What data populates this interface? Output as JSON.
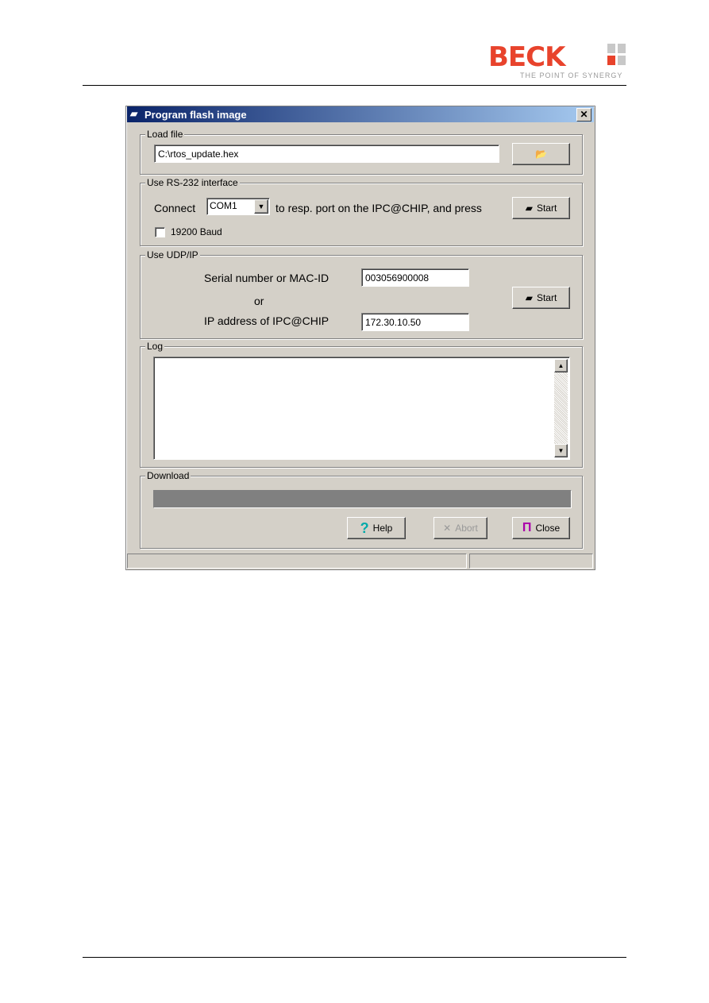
{
  "header": {
    "logo": "BECK",
    "tagline": "THE POINT OF SYNERGY"
  },
  "dialog": {
    "title": "Program flash image",
    "close": "✕",
    "load_file": {
      "label": "Load file",
      "path": "C:\\rtos_update.hex"
    },
    "rs232": {
      "label": "Use RS-232 interface",
      "connect": "Connect",
      "port": "COM1",
      "text": "to resp. port on the IPC@CHIP, and press",
      "start": "Start",
      "baud_label": "19200 Baud",
      "baud_checked": false
    },
    "udp": {
      "label": "Use UDP/IP",
      "serial_label": "Serial number or MAC-ID",
      "serial_value": "003056900008",
      "or": "or",
      "ip_label": "IP address of IPC@CHIP",
      "ip_value": "172.30.10.50",
      "start": "Start"
    },
    "log": {
      "label": "Log",
      "content": ""
    },
    "download": {
      "label": "Download",
      "progress": 0,
      "help": "Help",
      "abort": "Abort",
      "close": "Close"
    }
  }
}
